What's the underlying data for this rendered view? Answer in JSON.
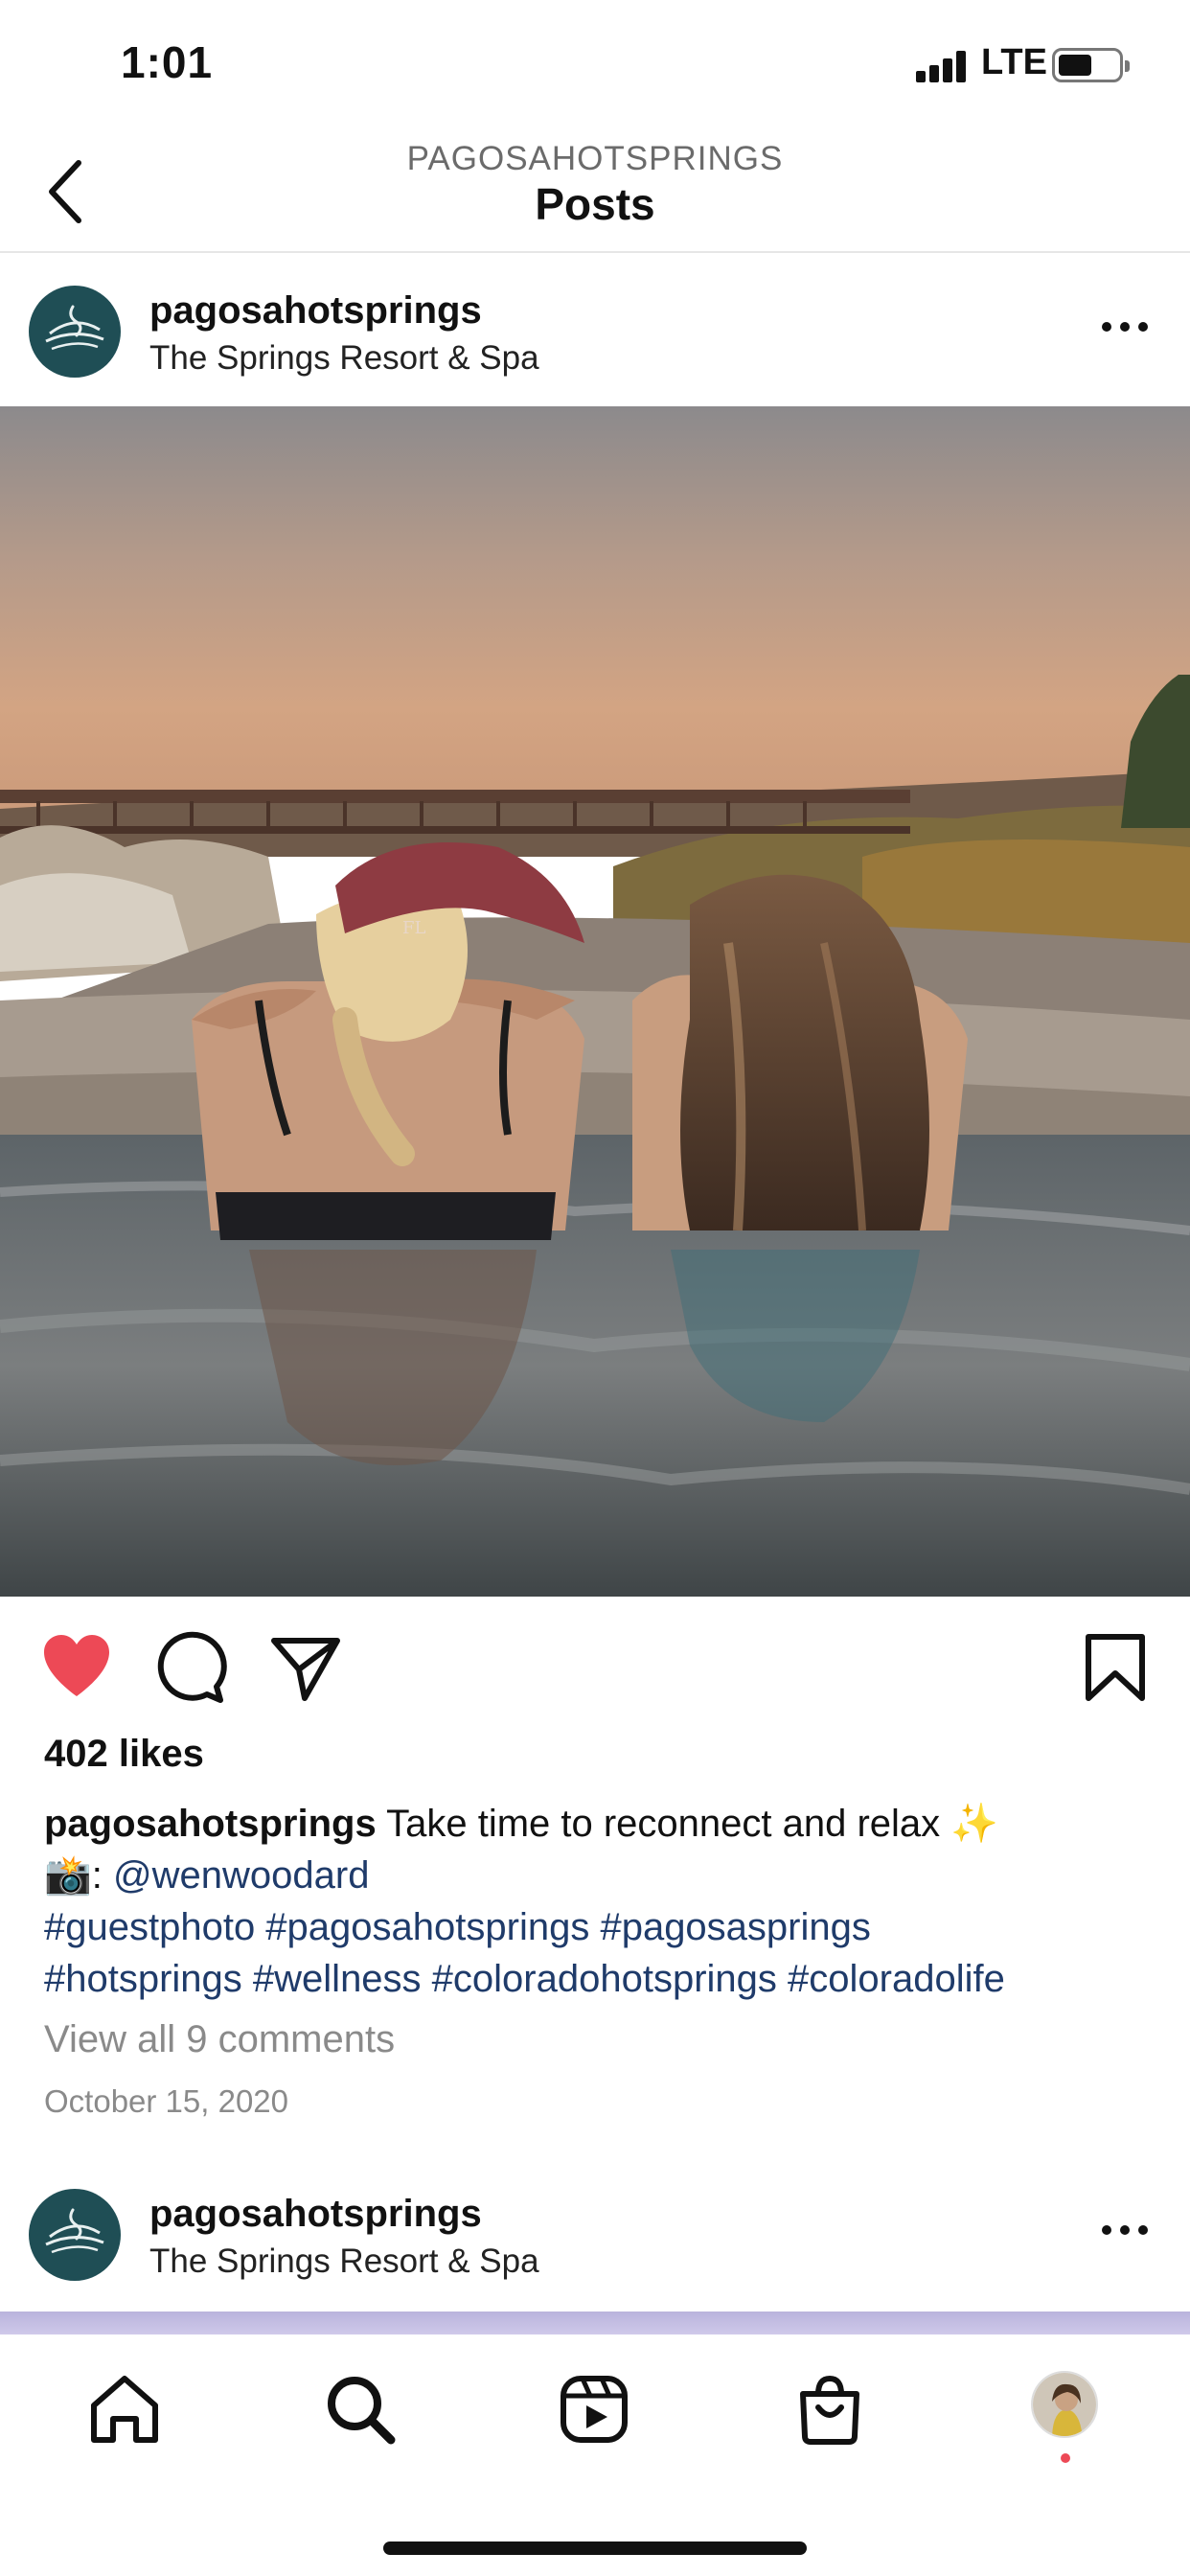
{
  "status_bar": {
    "time": "1:01",
    "network": "LTE",
    "battery_level": 0.55
  },
  "header": {
    "subtitle": "PAGOSAHOTSPRINGS",
    "title": "Posts"
  },
  "post": {
    "username": "pagosahotsprings",
    "location": "The Springs Resort & Spa",
    "liked": true,
    "likes_text": "402 likes",
    "caption_user": "pagosahotsprings",
    "caption_text": " Take time to reconnect and relax ✨",
    "photo_credit_prefix": "📸: ",
    "photo_credit_handle": "@wenwoodard",
    "hashtags_line1": "#guestphoto #pagosahotsprings #pagosasprings",
    "hashtags_line2": "#hotsprings #wellness #coloradohotsprings #coloradolife",
    "view_comments": "View all 9 comments",
    "date": "October 15, 2020"
  },
  "next_post": {
    "username": "pagosahotsprings",
    "location": "The Springs Resort & Spa"
  },
  "colors": {
    "like_red": "#ed4956",
    "link_blue": "#1f3b6a",
    "avatar_teal": "#1f4e55"
  },
  "tab_bar": {
    "items": [
      "home-icon",
      "search-icon",
      "reels-icon",
      "shop-icon",
      "profile-avatar"
    ]
  }
}
